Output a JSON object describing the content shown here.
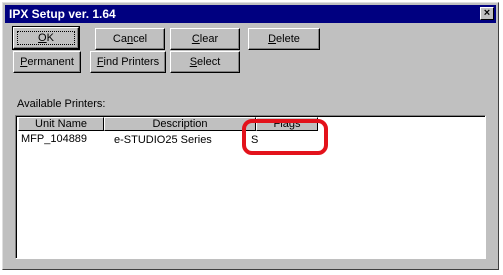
{
  "window": {
    "title": "IPX Setup ver. 1.64",
    "close_symbol": "×"
  },
  "buttons": {
    "ok": {
      "prefix": "",
      "mnemonic": "O",
      "rest": "K"
    },
    "cancel": {
      "prefix": "Ca",
      "mnemonic": "n",
      "rest": "cel"
    },
    "clear": {
      "prefix": "",
      "mnemonic": "C",
      "rest": "lear"
    },
    "delete": {
      "prefix": "",
      "mnemonic": "D",
      "rest": "elete"
    },
    "permanent": {
      "prefix": "",
      "mnemonic": "P",
      "rest": "ermanent"
    },
    "find_printers": {
      "prefix": "",
      "mnemonic": "F",
      "rest": "ind Printers"
    },
    "select": {
      "prefix": "",
      "mnemonic": "S",
      "rest": "elect"
    }
  },
  "printers_section": {
    "label": "Available Printers:",
    "columns": [
      "Unit Name",
      "Description",
      "Flags"
    ],
    "rows": [
      {
        "unit_name": "MFP_104889",
        "description": "e-STUDIO25 Series",
        "flags": "S"
      }
    ]
  },
  "annotation": {
    "highlight_color": "#e3121b",
    "target": "Flags"
  }
}
